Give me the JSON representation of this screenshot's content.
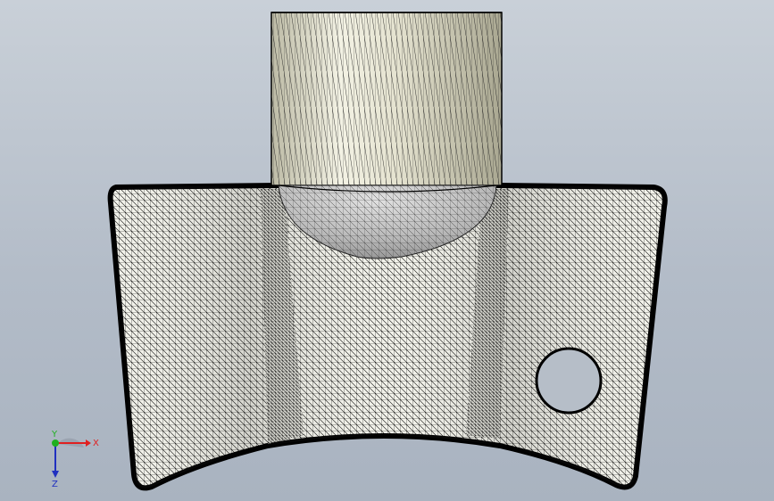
{
  "viewport": {
    "background_top": "#c9d0d8",
    "background_bottom": "#a9b3c0"
  },
  "model": {
    "body_color": "#f2f2ea",
    "mesh_color": "#000000",
    "cylinder_color": "#e6e4d2",
    "hole_color": "#b6bec8"
  },
  "triad": {
    "x_label": "X",
    "y_label": "Y",
    "z_label": "Z",
    "x_color": "#e02020",
    "y_color": "#20b020",
    "z_color": "#2030c0"
  }
}
